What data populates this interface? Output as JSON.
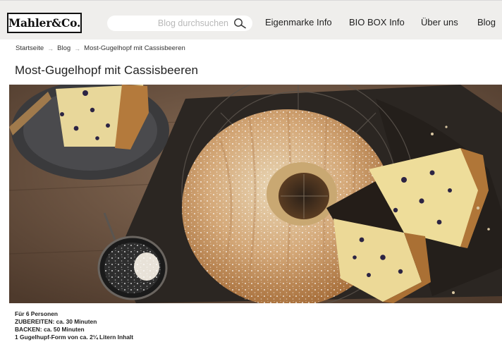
{
  "header": {
    "logo_text": "Mahler&Co.",
    "search": {
      "placeholder": "Blog durchsuchen",
      "value": ""
    },
    "nav": [
      "Eigenmarke Info",
      "BIO BOX Info",
      "Über uns",
      "Blog"
    ]
  },
  "breadcrumb": {
    "items": [
      "Startseite",
      "Blog",
      "Most-Gugelhopf mit Cassisbeeren"
    ],
    "separator": "→"
  },
  "page": {
    "title": "Most-Gugelhopf mit Cassisbeeren"
  },
  "recipe": {
    "lines": [
      "Für 6 Personen",
      "ZUBEREITEN: ca. 30 Minuten",
      "BACKEN: ca. 50 Minuten",
      "1 Gugelhupf-Form von ca. 2¼ Litern Inhalt"
    ]
  }
}
